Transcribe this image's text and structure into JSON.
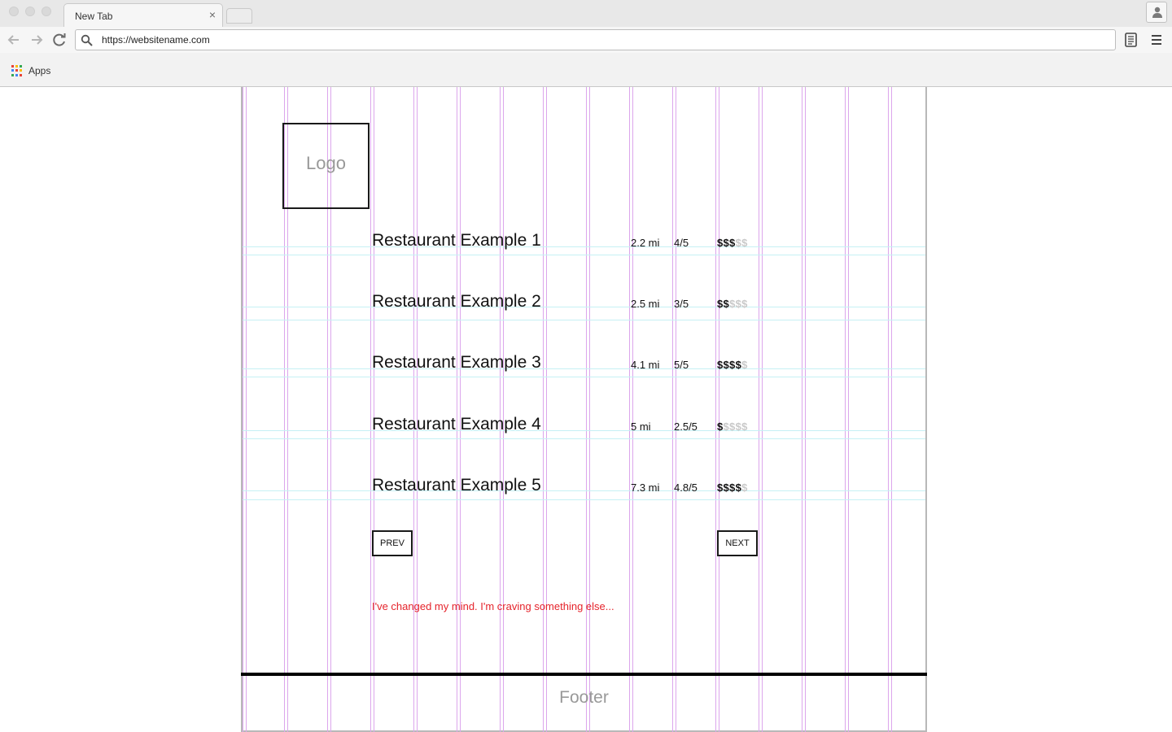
{
  "browser": {
    "tab_title": "New Tab",
    "tab_close": "×",
    "url": "https://websitename.com",
    "bookmarks_label": "Apps"
  },
  "page": {
    "logo": "Logo",
    "restaurants": [
      {
        "name": "Restaurant Example 1",
        "distance": "2.2 mi",
        "rating": "4/5",
        "price_on": "$$$",
        "price_off": "$$"
      },
      {
        "name": "Restaurant Example 2",
        "distance": "2.5 mi",
        "rating": "3/5",
        "price_on": "$$",
        "price_off": "$$$"
      },
      {
        "name": "Restaurant Example 3",
        "distance": "4.1 mi",
        "rating": "5/5",
        "price_on": "$$$$",
        "price_off": "$"
      },
      {
        "name": "Restaurant Example 4",
        "distance": "5 mi",
        "rating": "2.5/5",
        "price_on": "$",
        "price_off": "$$$$"
      },
      {
        "name": "Restaurant Example 5",
        "distance": "7.3 mi",
        "rating": "4.8/5",
        "price_on": "$$$$",
        "price_off": "$"
      }
    ],
    "prev_label": "PREV",
    "next_label": "NEXT",
    "craving_link": "I've changed my mind. I'm craving something else...",
    "footer": "Footer"
  },
  "colors": {
    "link_red": "#e5232b",
    "grid_column": "#dca6ec",
    "grid_row": "#c6f0f4",
    "price_inactive": "#c9c9c9"
  }
}
